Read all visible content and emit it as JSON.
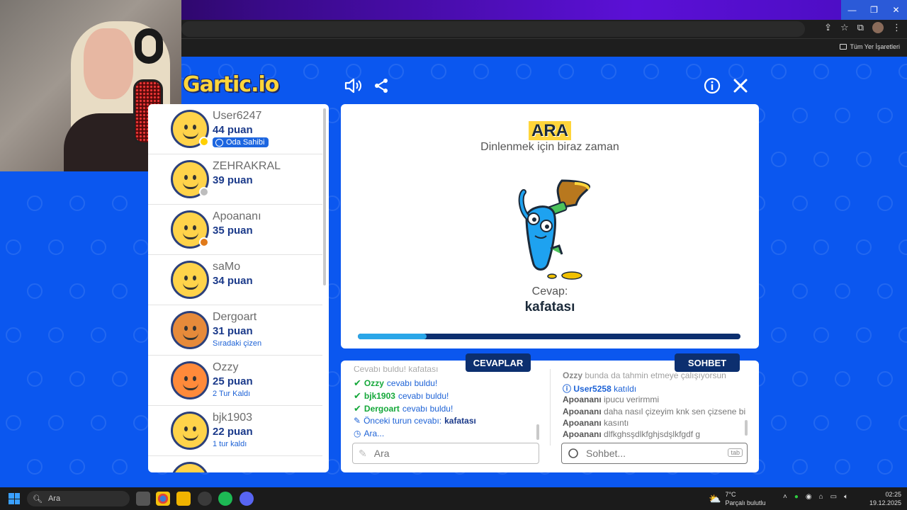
{
  "browser": {
    "bookmarks_label": "Tüm Yer İşaretleri"
  },
  "game": {
    "logo": "Gartic.io",
    "board": {
      "title": "ARA",
      "subtitle": "Dinlenmek için biraz zaman",
      "answer_label": "Cevap:",
      "answer_value": "kafatası",
      "progress": 0.18
    },
    "players": [
      {
        "name": "User6247",
        "score": "44 puan",
        "badge": "Oda Sahibi",
        "sub": "",
        "status_color": "#ffd000"
      },
      {
        "name": "ZEHRAKRAL",
        "score": "39 puan",
        "badge": "",
        "sub": "",
        "status_color": "#bdbdbd"
      },
      {
        "name": "Apoananı",
        "score": "35 puan",
        "badge": "",
        "sub": "",
        "status_color": "#e07a1a"
      },
      {
        "name": "saMo",
        "score": "34 puan",
        "badge": "",
        "sub": "",
        "status_color": ""
      },
      {
        "name": "Dergoart",
        "score": "31 puan",
        "badge": "",
        "sub": "Sıradaki çizen",
        "status_color": ""
      },
      {
        "name": "Ozzy",
        "score": "25 puan",
        "badge": "",
        "sub": "2 Tur Kaldı",
        "status_color": ""
      },
      {
        "name": "bjk1903",
        "score": "22 puan",
        "badge": "",
        "sub": "1 tur kaldı",
        "status_color": ""
      }
    ],
    "tabs": {
      "answers": "CEVAPLAR",
      "chat": "SOHBET"
    },
    "answers": {
      "partial_top": "Cevabı buldu! kafatası",
      "lines": [
        {
          "user": "Ozzy",
          "text": "cevabı buldu!"
        },
        {
          "user": "bjk1903",
          "text": "cevabı buldu!"
        },
        {
          "user": "Dergoart",
          "text": "cevabı buldu!"
        }
      ],
      "prev_label": "Önceki turun cevabı:",
      "prev_value": "kafatası",
      "searching": "Ara...",
      "input_placeholder": "Ara"
    },
    "chat": {
      "lines": [
        {
          "user": "Ozzy",
          "text": "bunda da tahmin etmeye çalışıyorsun"
        },
        {
          "user": "User5258",
          "text": "katıldı",
          "join": true
        },
        {
          "user": "Apoananı",
          "text": "ipucu verirmmi"
        },
        {
          "user": "Apoananı",
          "text": "daha nasıl çizeyim knk sen çizsene bi"
        },
        {
          "user": "Apoananı",
          "text": "kasıntı"
        },
        {
          "user": "Apoananı",
          "text": "dlfkghsşdlkfghjsdşlkfgdf g"
        }
      ],
      "input_placeholder": "Sohbet...",
      "tab_key": "tab"
    }
  },
  "taskbar": {
    "search_label": "Ara",
    "weather_temp": "7°C",
    "weather_desc": "Parçalı bulutlu",
    "weather_badge": "2",
    "time": "02:25",
    "date": "19.12.2025"
  }
}
